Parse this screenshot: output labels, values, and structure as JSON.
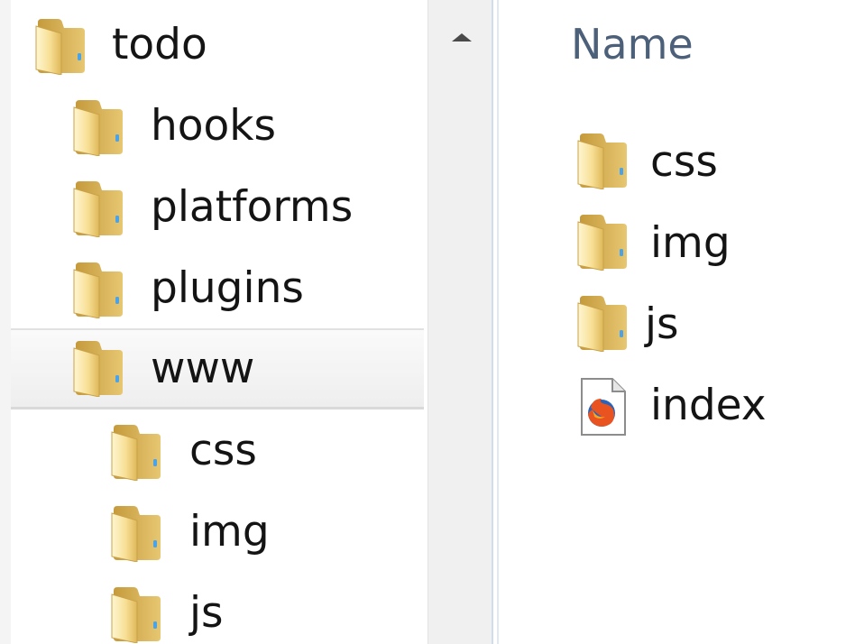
{
  "tree": {
    "items": [
      {
        "label": "todo",
        "icon": "folder-icon"
      },
      {
        "label": "hooks",
        "icon": "folder-icon"
      },
      {
        "label": "platforms",
        "icon": "folder-icon"
      },
      {
        "label": "plugins",
        "icon": "folder-icon"
      },
      {
        "label": "www",
        "icon": "folder-icon",
        "selected": true
      },
      {
        "label": "css",
        "icon": "folder-icon"
      },
      {
        "label": "img",
        "icon": "folder-icon"
      },
      {
        "label": "js",
        "icon": "folder-icon"
      }
    ]
  },
  "scrollbar": {
    "up_arrow_icon": "triangle-up-icon"
  },
  "content": {
    "column_header": "Name",
    "items": [
      {
        "label": "css",
        "icon": "folder-icon"
      },
      {
        "label": "img",
        "icon": "folder-icon"
      },
      {
        "label": "js",
        "icon": "folder-icon"
      },
      {
        "label": "index",
        "icon": "firefox-html-file-icon"
      }
    ]
  },
  "colors": {
    "folder_light": "#fbe7a6",
    "folder_dark": "#d9b65a",
    "header_text": "#4c607a",
    "selection": "#eeeeee"
  }
}
